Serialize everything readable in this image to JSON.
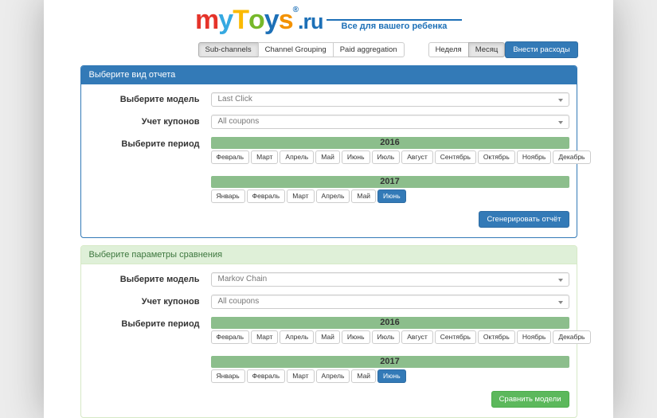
{
  "logo": {
    "letters": [
      {
        "ch": "m",
        "color": "#e5332a"
      },
      {
        "ch": "y",
        "color": "#36a9e1"
      },
      {
        "ch": "T",
        "color": "#fbba00"
      },
      {
        "ch": "o",
        "color": "#76b82a"
      },
      {
        "ch": "y",
        "color": "#1d70b7"
      },
      {
        "ch": "s",
        "color": "#f39200"
      }
    ],
    "registered": "®",
    "domain": ".ru",
    "tagline": "Все для вашего ребенка"
  },
  "toolbar": {
    "view_buttons": [
      {
        "label": "Sub-channels",
        "active": true
      },
      {
        "label": "Channel Grouping",
        "active": false
      },
      {
        "label": "Paid aggregation",
        "active": false
      }
    ],
    "period_buttons": [
      {
        "label": "Неделя",
        "active": false
      },
      {
        "label": "Месяц",
        "active": true
      }
    ],
    "expenses_button": "Внести расходы"
  },
  "report_panel": {
    "title": "Выберите вид отчета",
    "model_label": "Выберите модель",
    "model_value": "Last Click",
    "coupons_label": "Учет купонов",
    "coupons_value": "All coupons",
    "period_label": "Выберите период",
    "years": [
      {
        "year": "2016",
        "months": [
          "Февраль",
          "Март",
          "Апрель",
          "Май",
          "Июнь",
          "Июль",
          "Август",
          "Сентябрь",
          "Октябрь",
          "Ноябрь",
          "Декабрь"
        ],
        "selected": null
      },
      {
        "year": "2017",
        "months": [
          "Январь",
          "Февраль",
          "Март",
          "Апрель",
          "Май",
          "Июнь"
        ],
        "selected": "Июнь"
      }
    ],
    "generate_button": "Сгенерировать отчёт"
  },
  "compare_panel": {
    "title": "Выберите параметры сравнения",
    "model_label": "Выберите модель",
    "model_value": "Markov Chain",
    "coupons_label": "Учет купонов",
    "coupons_value": "All coupons",
    "period_label": "Выберите период",
    "years": [
      {
        "year": "2016",
        "months": [
          "Февраль",
          "Март",
          "Апрель",
          "Май",
          "Июнь",
          "Июль",
          "Август",
          "Сентябрь",
          "Октябрь",
          "Ноябрь",
          "Декабрь"
        ],
        "selected": null
      },
      {
        "year": "2017",
        "months": [
          "Январь",
          "Февраль",
          "Март",
          "Апрель",
          "Май",
          "Июнь"
        ],
        "selected": "Июнь"
      }
    ],
    "compare_button": "Сравнить модели"
  },
  "colors": {
    "primary_blue": "#337ab7",
    "success_green": "#5cb85c",
    "year_bar_green": "#8cbe8c",
    "panel_success_bg": "#dff0d8",
    "panel_success_text": "#3c763d",
    "panel_success_border": "#d6e9c6",
    "logo_blue": "#1d70b7"
  }
}
